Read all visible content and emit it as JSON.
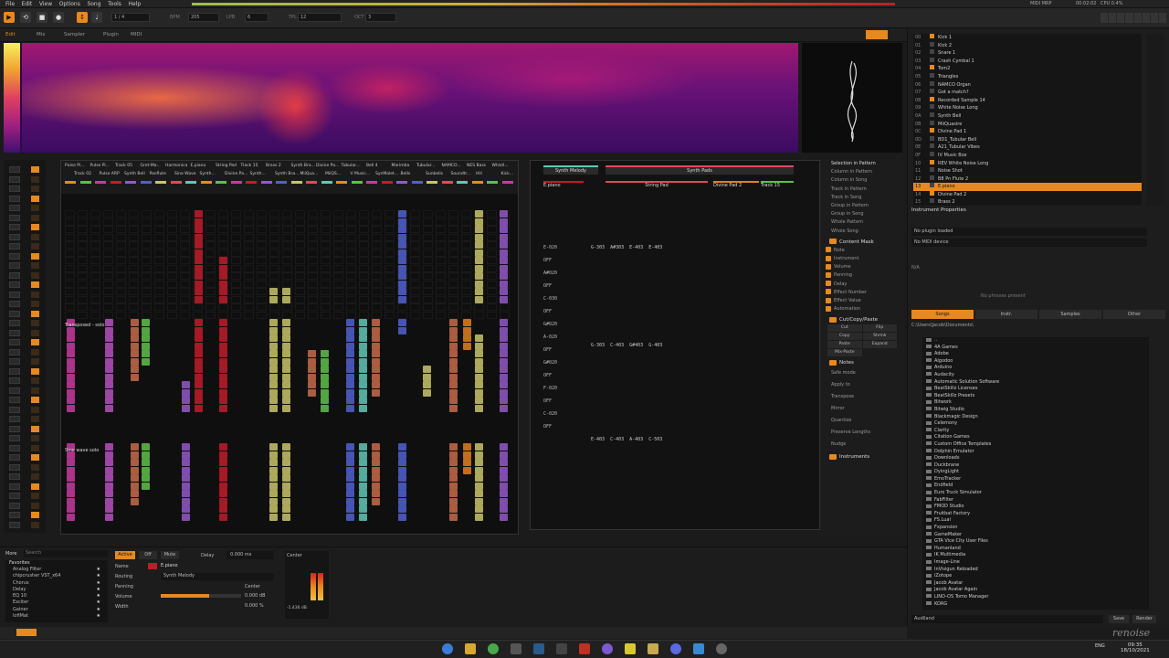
{
  "menu": [
    "File",
    "Edit",
    "View",
    "Options",
    "Song",
    "Tools",
    "Help"
  ],
  "transport": {
    "bpm_label": "BPM",
    "bpm": "205",
    "lpb_label": "LPB",
    "lpb": "6",
    "tpl_label": "TPL",
    "tpl": "12",
    "oct_label": "OCT",
    "oct": "3",
    "edit_step_label": "EDIT",
    "edit_step": "0",
    "pos": "1 / 4"
  },
  "top_right": {
    "midi": "MIDI MRP",
    "time": "00:02:02",
    "cpu": "CPU 0.4%"
  },
  "tabs": [
    "Edit",
    "Mix",
    "Sampler",
    "Plugin",
    "MIDI"
  ],
  "track_headers_row1": [
    "Pulse Pi...",
    "Pulse Pi...",
    "Track 05",
    "Gret-Ma...",
    "Harmonica",
    "E.piano",
    "String Pad",
    "Track 15",
    "Brass 2",
    "Synth Bra...",
    "Divine Pa...",
    "Tubular...",
    "Bell 4",
    "Marimba",
    "Tubular...",
    "NAMCO...",
    "NES Bass",
    "Whistl..."
  ],
  "track_headers_row2": [
    "Track 02",
    "Pulse ARP",
    "Synth Bell",
    "Panflute",
    "Sine Wave",
    "Synth...",
    "Divine Pa...",
    "Synth...",
    "Synth Bra...",
    "MiiQua...",
    "MiiQS...",
    "V Music...",
    "SynMalet...",
    "Bells",
    "Sunbells",
    "Soundtr...",
    "HH",
    "Kick..."
  ],
  "pattern_labels": {
    "transposed": "Transposed - solo",
    "sine": "Sine wave solo"
  },
  "phrase": {
    "group1": "Synth Melody",
    "group2": "Synth Pads",
    "col1": "E.piano",
    "col2": "String Pad",
    "col3": "Divine Pad 2",
    "col4": "Track 15",
    "col_label": "Note",
    "fx_label": "FX",
    "play": "PLAY",
    "rows_left": [
      "E-020",
      "OFF",
      "A#020",
      "OFF",
      "C-030",
      "OFF",
      "G#020",
      "A-020",
      "OFF",
      "G#020",
      "OFF",
      "F-020",
      "OFF",
      "C-020",
      "OFF"
    ],
    "rows_mid": [
      "G-303  A#303  E-403  E-403",
      "G-303  C-403  G#403  G-403",
      "E-403  C-403  A-403  C-503"
    ]
  },
  "side": {
    "scope_label": "Selection in Pattern",
    "scopes": [
      "Column in Pattern",
      "Column in Song",
      "Track in Pattern",
      "Track in Song",
      "Group in Pattern",
      "Group in Song",
      "Whole Pattern",
      "Whole Song"
    ],
    "mask_head": "Content Mask",
    "mask": [
      "Note",
      "Instrument",
      "Volume",
      "Panning",
      "Delay",
      "Effect Number",
      "Effect Value",
      "Automation"
    ],
    "ccp_head": "Cut/Copy/Paste",
    "ccp": [
      "Cut",
      "Flip",
      "Copy",
      "Shrink",
      "Paste",
      "Expand",
      "Mix-Paste"
    ],
    "notes_head": "Notes",
    "notes": [
      "Safe mode",
      "Apply to",
      "Transpose",
      "Mirror",
      "Quantize",
      "Preserve Lengths",
      "Nudge"
    ],
    "instruments_head": "Instruments"
  },
  "instruments": [
    "Kick 1",
    "Kick 2",
    "Snare 1",
    "Crash Cymbal 1",
    "Tom2",
    "Triangles",
    "NAMCO Organ",
    "Got a match?",
    "Recorded Sample 14",
    "White Noise Long",
    "Synth Bell",
    "MiiQuasire",
    "Divine Pad 1",
    "BD1_Tubular Bell",
    "A21_Tubular Vibes",
    "IV Music Box",
    "REV White Noise Long",
    "Noise Shot",
    "B8 Pn Flute 2",
    "E.piano",
    "Divine Pad 2",
    "Brass 2",
    "Bell 4",
    "Marimba"
  ],
  "instrument_numbers": [
    "00",
    "01",
    "02",
    "03",
    "04",
    "05",
    "06",
    "07",
    "08",
    "09",
    "0A",
    "0B",
    "0C",
    "0D",
    "0E",
    "0F",
    "10",
    "11",
    "12",
    "13",
    "14",
    "15",
    "16",
    "17"
  ],
  "inst_props": {
    "title": "Instrument Properties",
    "plugin": "No plugin loaded",
    "midi": "No MIDI device",
    "na": "N/A",
    "no_preset": "No phrases present",
    "tabs": [
      "Songs",
      "Instr.",
      "Samples",
      "Other"
    ],
    "path": "C:\\Users\\Jacob\\Documents\\"
  },
  "files": [
    "..",
    "4A Games",
    "Adobe",
    "Algodoo",
    "Arduino",
    "Audacity",
    "Automatic Solution Software",
    "BeatSkillz Licenses",
    "BeatSkillz Presets",
    "Bitwork",
    "Bitwig Studio",
    "Blackmagic Design",
    "Celemony",
    "Clarity",
    "Citation Games",
    "Custom Office Templates",
    "Dolphin Emulator",
    "Downloads",
    "Duckbrane",
    "DyingLight",
    "EmoTracker",
    "Endfield",
    "Euro Truck Simulator",
    "FabFilter",
    "FMOD Studio",
    "Fruitbat Factory",
    "FS.Lual",
    "Fxpansion",
    "GameMaker",
    "GTA Vice City User Files",
    "Humanland",
    "IK Multimedia",
    "Image-Line",
    "InVisigun Reloaded",
    "iZotope",
    "Jacob Avatar",
    "Jacob Avatar Again",
    "LINO-OS Tomo Manager",
    "KORG"
  ],
  "right_footer": {
    "name": "Audiland",
    "save": "Save",
    "render": "Render"
  },
  "bottom": {
    "more": "More",
    "search": "Search",
    "favorites": "Favorites",
    "devices": [
      "Analog Filter",
      "chipcrusher VST_x64",
      "Chorus",
      "Delay",
      "EQ 10",
      "Exciter",
      "Gainer",
      "lofiMat"
    ],
    "active": "Active",
    "off": "Off",
    "mute": "Mute",
    "delay": "Delay",
    "delay_val": "0.000 ms",
    "name_label": "Name",
    "name_val": "E.piano",
    "routing_label": "Routing",
    "routing_val": "Synth Melody",
    "panning_label": "Panning",
    "panning_val": "Center",
    "volume_label": "Volume",
    "volume_val": "0.000 dB",
    "width_label": "Width",
    "width_val": "0.000 %",
    "center": "Center",
    "meter": "-1.436 dB"
  },
  "brand": "renoise",
  "clock": {
    "time": "09:35",
    "date": "18/10/2021",
    "lang": "ENG"
  },
  "colors": {
    "accent": "#e8891e",
    "red": "#c01c2a",
    "pink": "#c83aa0",
    "green": "#5fbf4a",
    "yellow": "#c9c46a",
    "blue": "#5060d0",
    "teal": "#5fc8b5",
    "purple": "#9558c8",
    "orange": "#e08020",
    "salmon": "#c86a4a",
    "magenta": "#b84fc0"
  }
}
